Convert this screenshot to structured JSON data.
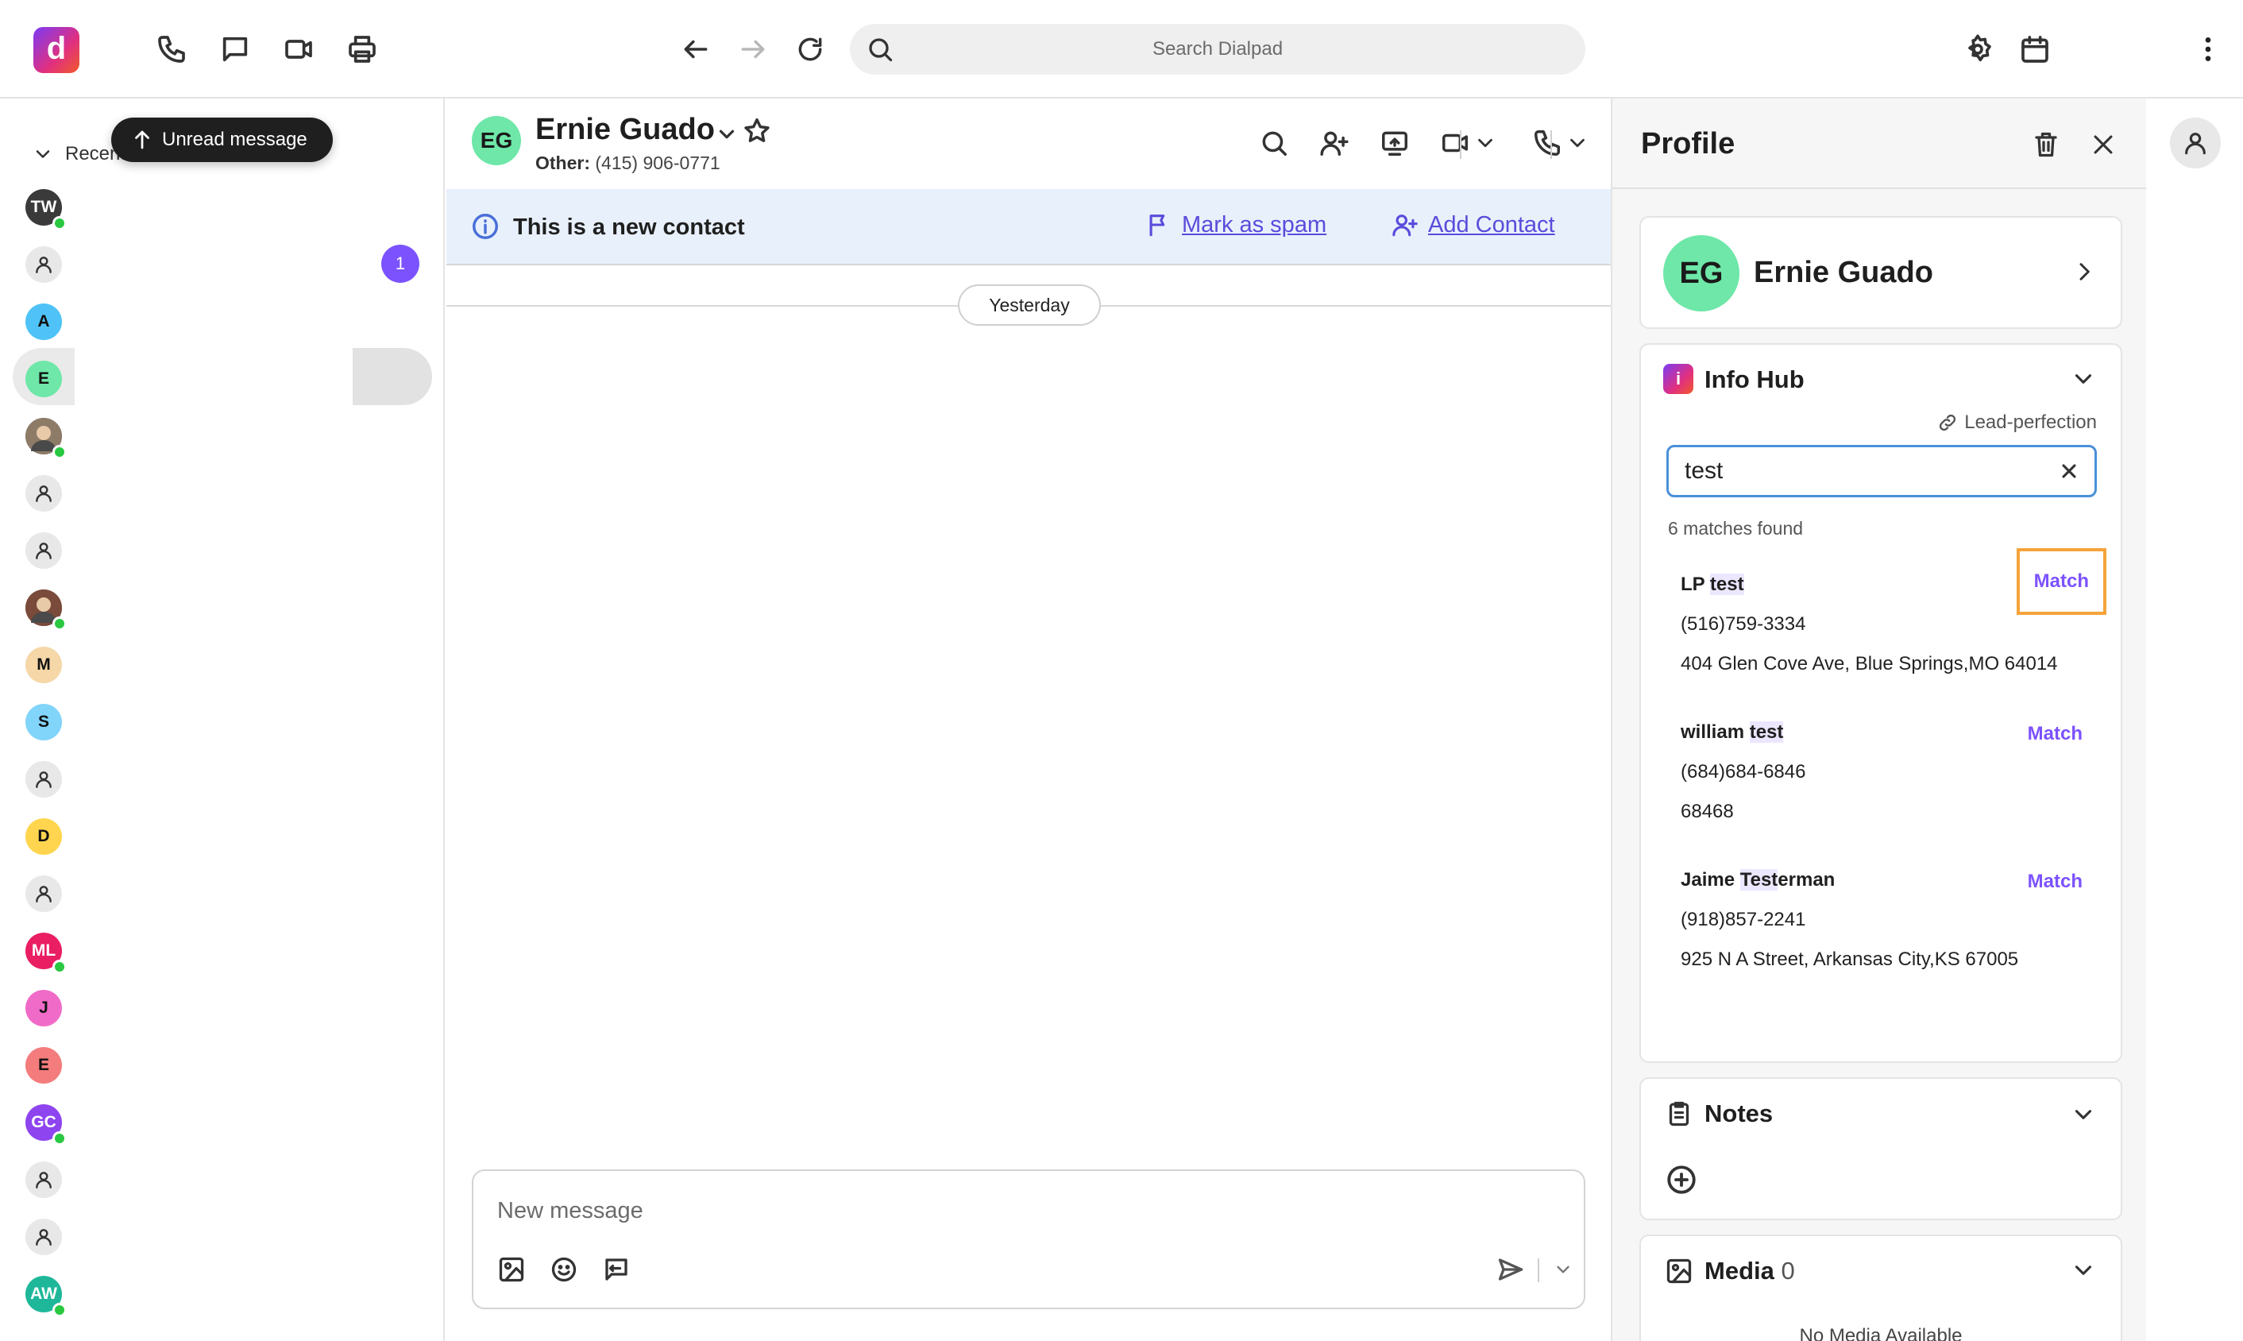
{
  "topbar": {
    "logo_letter": "d",
    "search_placeholder": "Search Dialpad"
  },
  "sidebar": {
    "recents_label": "Recents",
    "unread_tooltip": "Unread message",
    "unread_count": "1",
    "contacts": [
      {
        "initials": "TW",
        "color": "#3a3a3a",
        "text_color": "#ffffff",
        "online": true
      },
      {
        "initials": "",
        "generic": true,
        "online": false
      },
      {
        "initials": "A",
        "color": "#4fc3f7",
        "text_color": "#111111",
        "online": false
      },
      {
        "initials": "E",
        "color": "#6ee7a8",
        "text_color": "#111111",
        "online": false
      },
      {
        "initials": "",
        "photo": true,
        "color": "#8d7b68",
        "online": true
      },
      {
        "initials": "",
        "generic": true,
        "online": false
      },
      {
        "initials": "",
        "generic": true,
        "online": false
      },
      {
        "initials": "",
        "photo": true,
        "color": "#7a4a3a",
        "online": true
      },
      {
        "initials": "M",
        "color": "#f5d7a8",
        "text_color": "#111111",
        "online": false
      },
      {
        "initials": "S",
        "color": "#81d4fa",
        "text_color": "#111111",
        "online": false
      },
      {
        "initials": "",
        "generic": true,
        "online": false
      },
      {
        "initials": "D",
        "color": "#ffd54f",
        "text_color": "#111111",
        "online": false
      },
      {
        "initials": "",
        "generic": true,
        "online": false
      },
      {
        "initials": "ML",
        "color": "#e91e63",
        "text_color": "#ffffff",
        "online": true
      },
      {
        "initials": "J",
        "color": "#f06bc8",
        "text_color": "#111111",
        "online": false
      },
      {
        "initials": "E",
        "color": "#f47c7c",
        "text_color": "#111111",
        "online": false
      },
      {
        "initials": "GC",
        "color": "#8e44ef",
        "text_color": "#ffffff",
        "online": true
      },
      {
        "initials": "",
        "generic": true,
        "online": false
      },
      {
        "initials": "",
        "generic": true,
        "online": false
      },
      {
        "initials": "AW",
        "color": "#1fb79a",
        "text_color": "#ffffff",
        "online": true
      }
    ]
  },
  "conversation": {
    "avatar_initials": "EG",
    "contact_name": "Ernie Guado",
    "sub_label": "Other:",
    "sub_phone": "(415) 906-0771",
    "new_contact_text": "This is a new contact",
    "mark_spam_label": "Mark as spam",
    "add_contact_label": "Add Contact",
    "date_divider": "Yesterday",
    "message_placeholder": "New message"
  },
  "profile": {
    "title": "Profile",
    "card_initials": "EG",
    "card_name": "Ernie Guado",
    "info_hub": {
      "title": "Info Hub",
      "logo_letter": "i",
      "integration_label": "Lead-perfection",
      "search_value": "test",
      "matches_text": "6 matches found",
      "match_label": "Match",
      "results": [
        {
          "name_pre": "LP ",
          "name_hl": "test",
          "name_post": "",
          "phone": "(516)759-3334",
          "address": "404 Glen Cove Ave, Blue Springs,MO 64014"
        },
        {
          "name_pre": "william ",
          "name_hl": "test",
          "name_post": "",
          "phone": "(684)684-6846",
          "address": "68468"
        },
        {
          "name_pre": "Jaime ",
          "name_hl": "Test",
          "name_post": "erman",
          "phone": "(918)857-2241",
          "address": "925 N A Street, Arkansas City,KS 67005"
        }
      ]
    },
    "notes_title": "Notes",
    "media_title": "Media",
    "media_count": "0",
    "media_empty": "No Media Available"
  },
  "colors": {
    "accent": "#7c52ff",
    "link": "#5b4bdb",
    "banner_bg": "#e8f0fb",
    "avatar_green": "#6ee7a8",
    "focus_outline": "#f5a33b",
    "online": "#28c840"
  }
}
